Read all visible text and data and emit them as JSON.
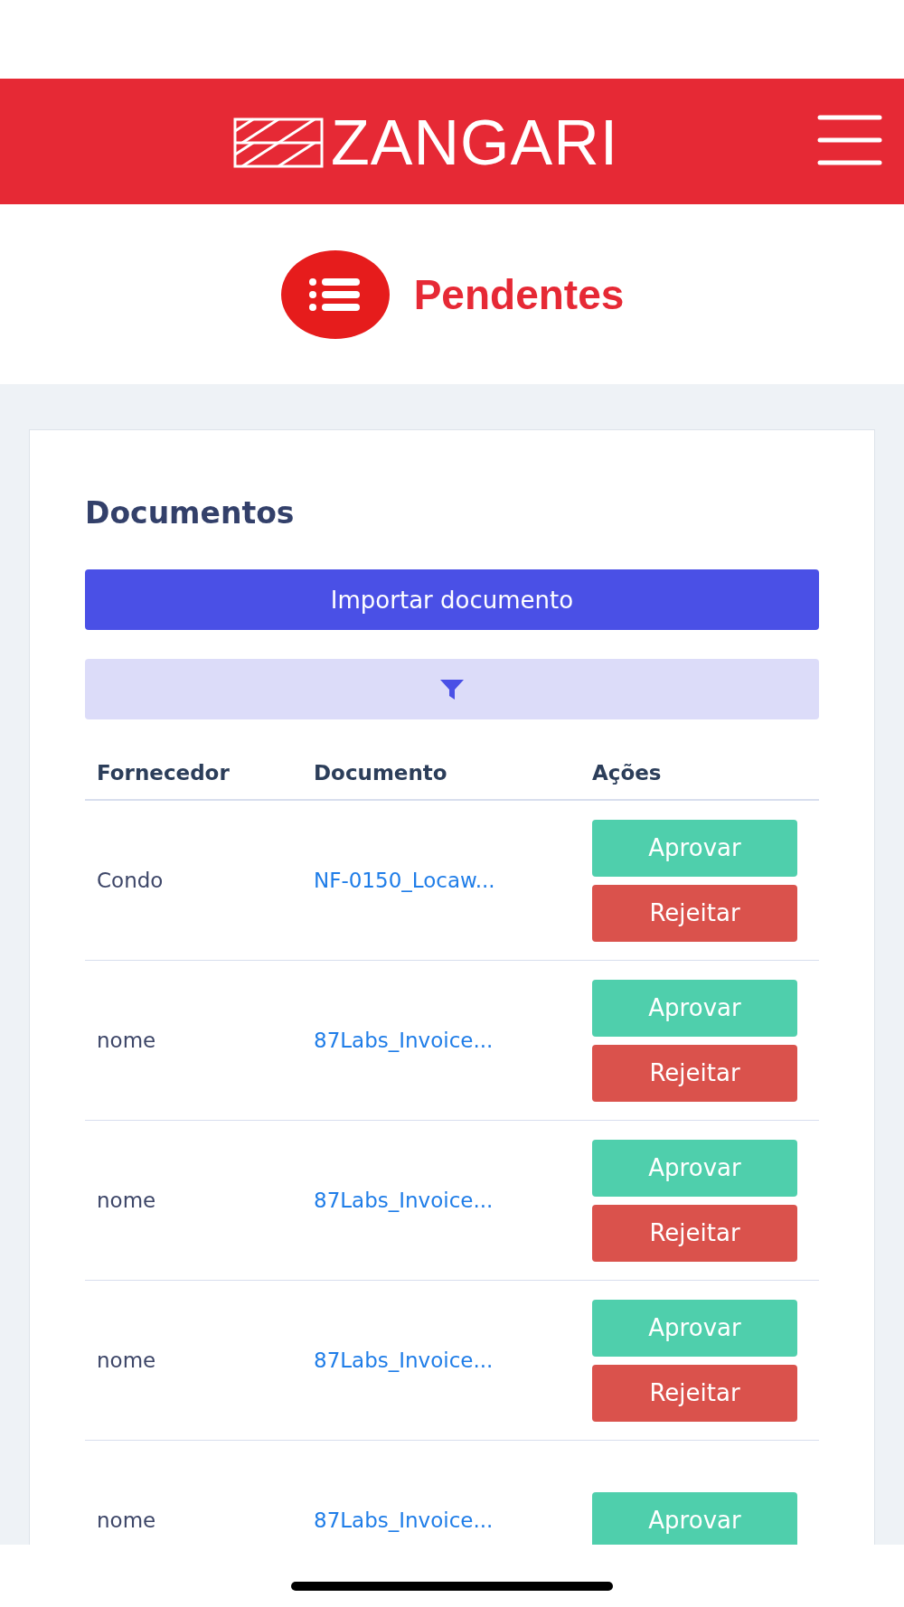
{
  "header": {
    "logo": "ZANGARI"
  },
  "page_title": "Pendentes",
  "card": {
    "title": "Documentos",
    "import_button": "Importar documento",
    "table": {
      "columns": [
        "Fornecedor",
        "Documento",
        "Ações"
      ],
      "rows": [
        {
          "supplier": "Condo",
          "document": "NF-0150_Locaw...",
          "approve": "Aprovar",
          "reject": "Rejeitar"
        },
        {
          "supplier": "nome",
          "document": "87Labs_Invoice...",
          "approve": "Aprovar",
          "reject": "Rejeitar"
        },
        {
          "supplier": "nome",
          "document": "87Labs_Invoice...",
          "approve": "Aprovar",
          "reject": "Rejeitar"
        },
        {
          "supplier": "nome",
          "document": "87Labs_Invoice...",
          "approve": "Aprovar",
          "reject": "Rejeitar"
        },
        {
          "supplier": "nome",
          "document": "87Labs_Invoice...",
          "approve": "Aprovar"
        }
      ]
    }
  }
}
